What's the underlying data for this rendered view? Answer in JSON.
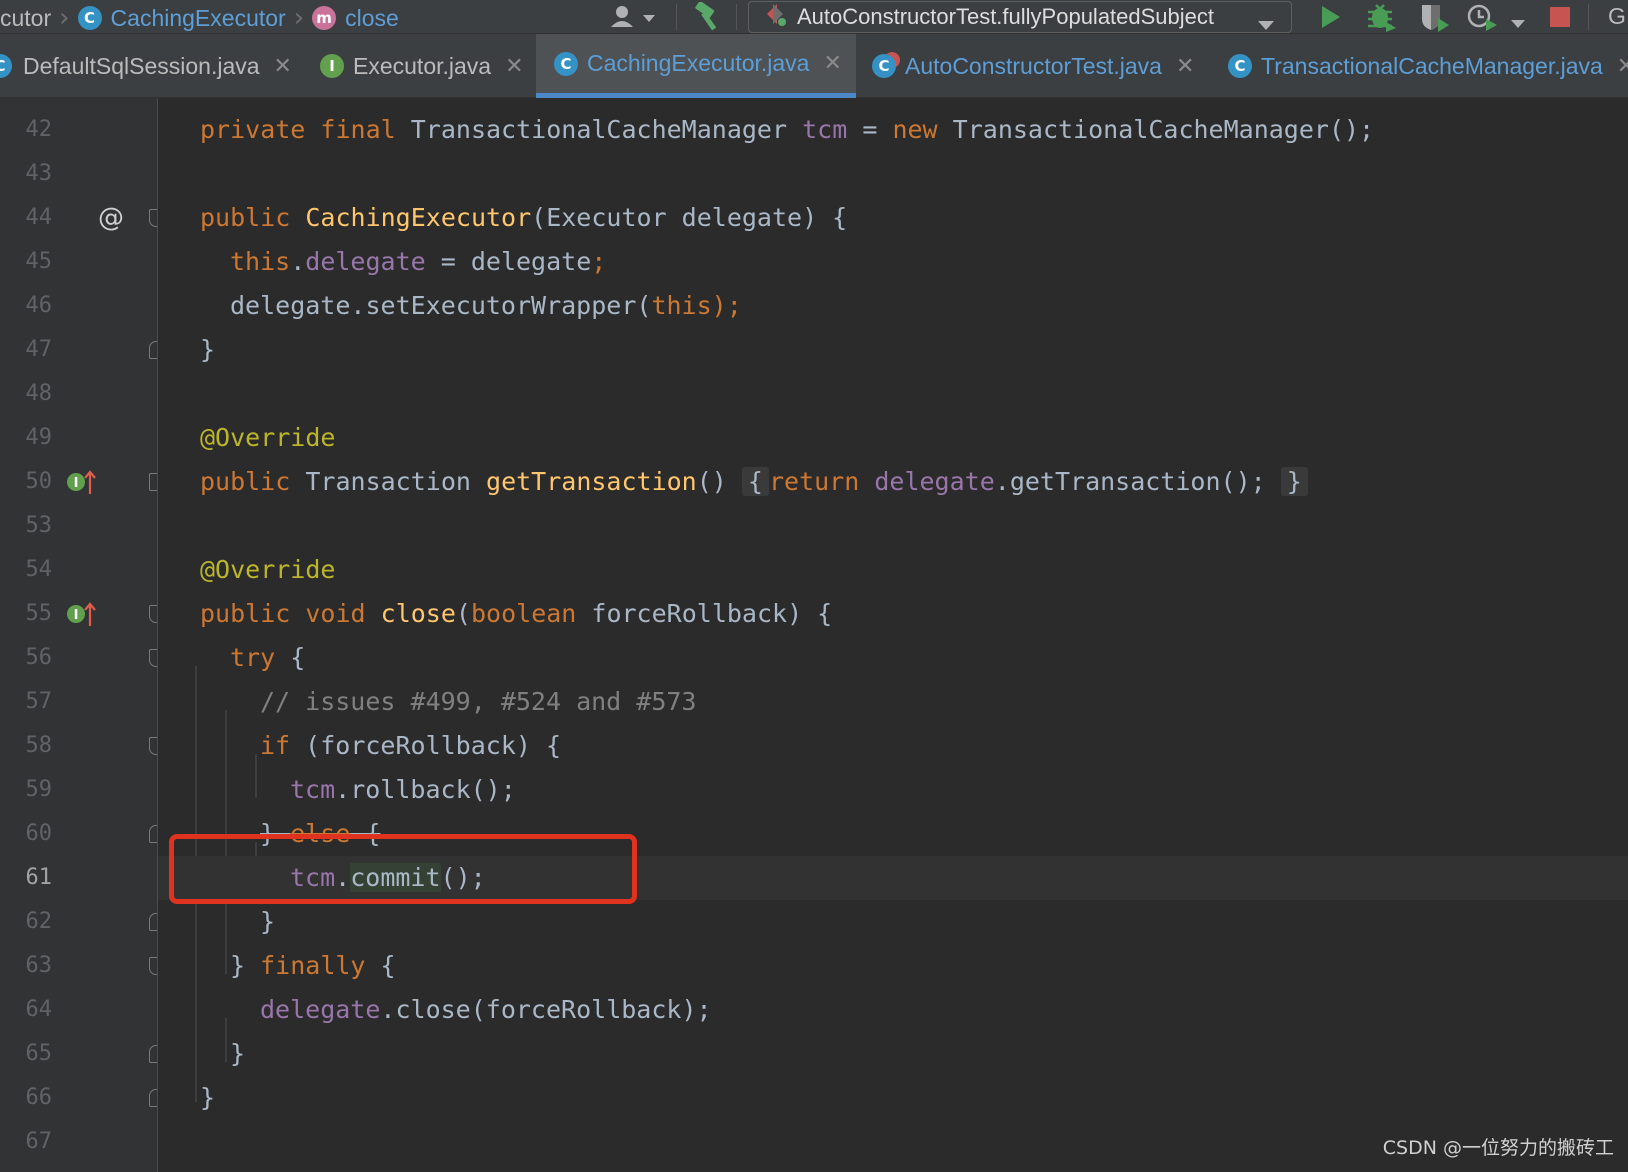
{
  "breadcrumb": {
    "items": [
      {
        "label": "cutor",
        "badge": ""
      },
      {
        "label": "CachingExecutor",
        "badge": "C"
      },
      {
        "label": "close",
        "badge": "m"
      }
    ]
  },
  "toolbar": {
    "run_config": "AutoConstructorTest.fullyPopulatedSubject",
    "right_edge_label": "G",
    "icons": [
      "user-icon",
      "build-hammer-icon",
      "run-icon",
      "debug-icon",
      "coverage-icon",
      "profile-icon",
      "stop-icon"
    ]
  },
  "tabs": [
    {
      "label": "DefaultSqlSession.java",
      "badge": "C",
      "active": false
    },
    {
      "label": "Executor.java",
      "badge": "I",
      "active": false
    },
    {
      "label": "CachingExecutor.java",
      "badge": "C",
      "active": true
    },
    {
      "label": "AutoConstructorTest.java",
      "badge": "C",
      "active": false
    },
    {
      "label": "TransactionalCacheManager.java",
      "badge": "C",
      "active": false
    }
  ],
  "gutter": {
    "line_numbers": [
      "42",
      "43",
      "44",
      "45",
      "46",
      "47",
      "48",
      "49",
      "50",
      "53",
      "54",
      "55",
      "56",
      "57",
      "58",
      "59",
      "60",
      "61",
      "62",
      "63",
      "64",
      "65",
      "66",
      "67"
    ],
    "current_line": "61",
    "markers": {
      "at_sign": "@",
      "implements_badge": "I",
      "override_arrow": "↑"
    }
  },
  "code": {
    "l42": [
      "private",
      "final",
      "TransactionalCacheManager",
      "tcm",
      "=",
      "new",
      "TransactionalCacheManager();"
    ],
    "l44": [
      "public",
      "CachingExecutor",
      "(Executor delegate) {"
    ],
    "l45": [
      "this",
      ".",
      "delegate",
      " = delegate",
      ";"
    ],
    "l46": [
      "delegate.setExecutorWrapper(",
      "this",
      ");"
    ],
    "l47": "}",
    "l49": "@Override",
    "l50": [
      "public",
      "Transaction",
      "getTransaction",
      "()",
      "{",
      "return",
      "delegate",
      ".getTransaction();",
      "}"
    ],
    "l54": "@Override",
    "l55": [
      "public",
      "void",
      "close",
      "(",
      "boolean",
      "forceRollback) {"
    ],
    "l56": [
      "try",
      "{"
    ],
    "l57": "// issues #499, #524 and #573",
    "l58": [
      "if",
      "(forceRollback) {"
    ],
    "l59": [
      "tcm",
      ".rollback();"
    ],
    "l60": [
      "}",
      "else",
      "{"
    ],
    "l61": [
      "tcm",
      ".",
      "commit",
      "();"
    ],
    "l62": "}",
    "l63": [
      "}",
      "finally",
      "{"
    ],
    "l64": [
      "delegate",
      ".close(forceRollback);"
    ],
    "l65": "}",
    "l66": "}"
  },
  "watermark": "CSDN @一位努力的搬砖工",
  "colors": {
    "keyword": "#cc7832",
    "function": "#ffc66d",
    "field": "#9876aa",
    "comment": "#808080",
    "annotation": "#bbb529",
    "text": "#a9b7c6",
    "highlight_box": "#e0331f",
    "tab_accent": "#4a88c7"
  }
}
